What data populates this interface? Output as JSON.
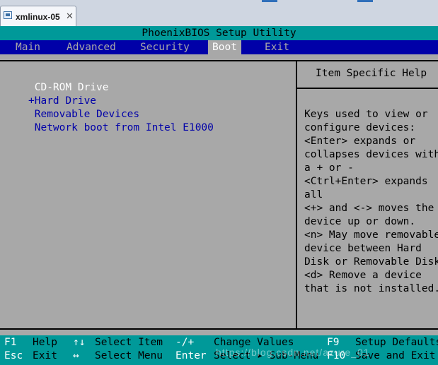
{
  "vm_tab": {
    "title": "xmlinux-05",
    "close_icon": "close-icon",
    "vm_icon": "vm-icon"
  },
  "bios": {
    "title": "PhoenixBIOS Setup Utility",
    "menu": [
      {
        "label": "Main",
        "active": false
      },
      {
        "label": "Advanced",
        "active": false
      },
      {
        "label": "Security",
        "active": false
      },
      {
        "label": "Boot",
        "active": true
      },
      {
        "label": "Exit",
        "active": false
      }
    ],
    "boot_items": [
      {
        "label": " CD-ROM Drive",
        "selected": true
      },
      {
        "label": "+Hard Drive",
        "selected": false
      },
      {
        "label": " Removable Devices",
        "selected": false
      },
      {
        "label": " Network boot from Intel E1000",
        "selected": false
      }
    ],
    "help_title": "Item Specific Help",
    "help_lines": [
      "Keys used to view or",
      "configure devices:",
      "<Enter> expands or",
      "collapses devices with",
      "a + or -",
      "<Ctrl+Enter> expands",
      "all",
      "<+> and <-> moves the",
      "device up or down.",
      "<n> May move removable",
      "device between Hard",
      "Disk or Removable Disk",
      "<d> Remove a device",
      "that is not installed."
    ],
    "footer_rows": [
      [
        {
          "key": "F1",
          "desc": "Help"
        },
        {
          "key": "↑↓",
          "desc": "Select Item"
        },
        {
          "key": "-/+",
          "desc": "Change Values"
        },
        {
          "key": "F9",
          "desc": "Setup Defaults"
        }
      ],
      [
        {
          "key": "Esc",
          "desc": "Exit"
        },
        {
          "key": "↔",
          "desc": "Select Menu"
        },
        {
          "key": "Enter",
          "desc": "Select ▸ Sub-Menu"
        },
        {
          "key": "F10",
          "desc": "Save and Exit"
        }
      ]
    ],
    "watermark": "https://blog.csdn.net/azure_01"
  },
  "colors": {
    "title_bg": "#009999",
    "menu_bg": "#0000a8",
    "body_bg": "#a8a8a8",
    "item_text": "#0000a8",
    "selected_text": "#ffffff"
  }
}
